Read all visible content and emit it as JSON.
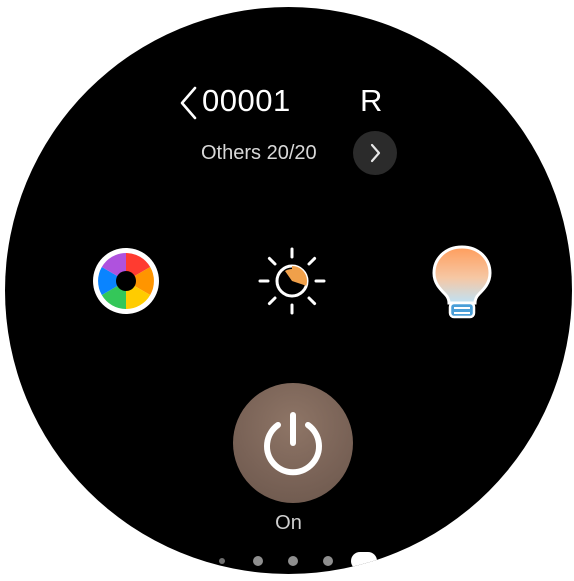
{
  "header": {
    "title": "00001",
    "title_right_partial": "R"
  },
  "subheader": {
    "label": "Others 20/20"
  },
  "controls": {
    "icons": [
      "color-wheel-icon",
      "brightness-icon",
      "color-temperature-bulb-icon"
    ]
  },
  "power": {
    "state_label": "On",
    "accent_color": "#7a6357"
  },
  "pagination": {
    "total_pages": 5,
    "current_page": 5
  }
}
